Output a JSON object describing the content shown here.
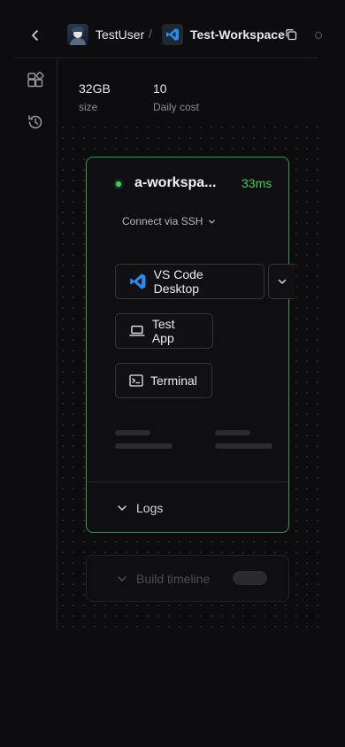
{
  "breadcrumb": {
    "user": "TestUser",
    "separator": "/",
    "workspace": "Test-Workspace"
  },
  "stats": [
    {
      "value": "32GB",
      "label": "size"
    },
    {
      "value": "10",
      "label": "Daily cost"
    }
  ],
  "agent": {
    "name": "a-workspa...",
    "latency": "33ms",
    "connect_label": "Connect via SSH",
    "status_color": "#3ecf5c",
    "apps": [
      {
        "label": "VS Code Desktop",
        "icon": "vscode-icon"
      },
      {
        "label": "Test App",
        "icon": "laptop-icon"
      },
      {
        "label": "Terminal",
        "icon": "terminal-icon"
      }
    ],
    "logs_label": "Logs"
  },
  "build_timeline": {
    "label": "Build timeline"
  },
  "colors": {
    "accent_green": "#3ecf5c",
    "vscode_blue": "#2a8bf2",
    "background": "#0d0d0f"
  }
}
